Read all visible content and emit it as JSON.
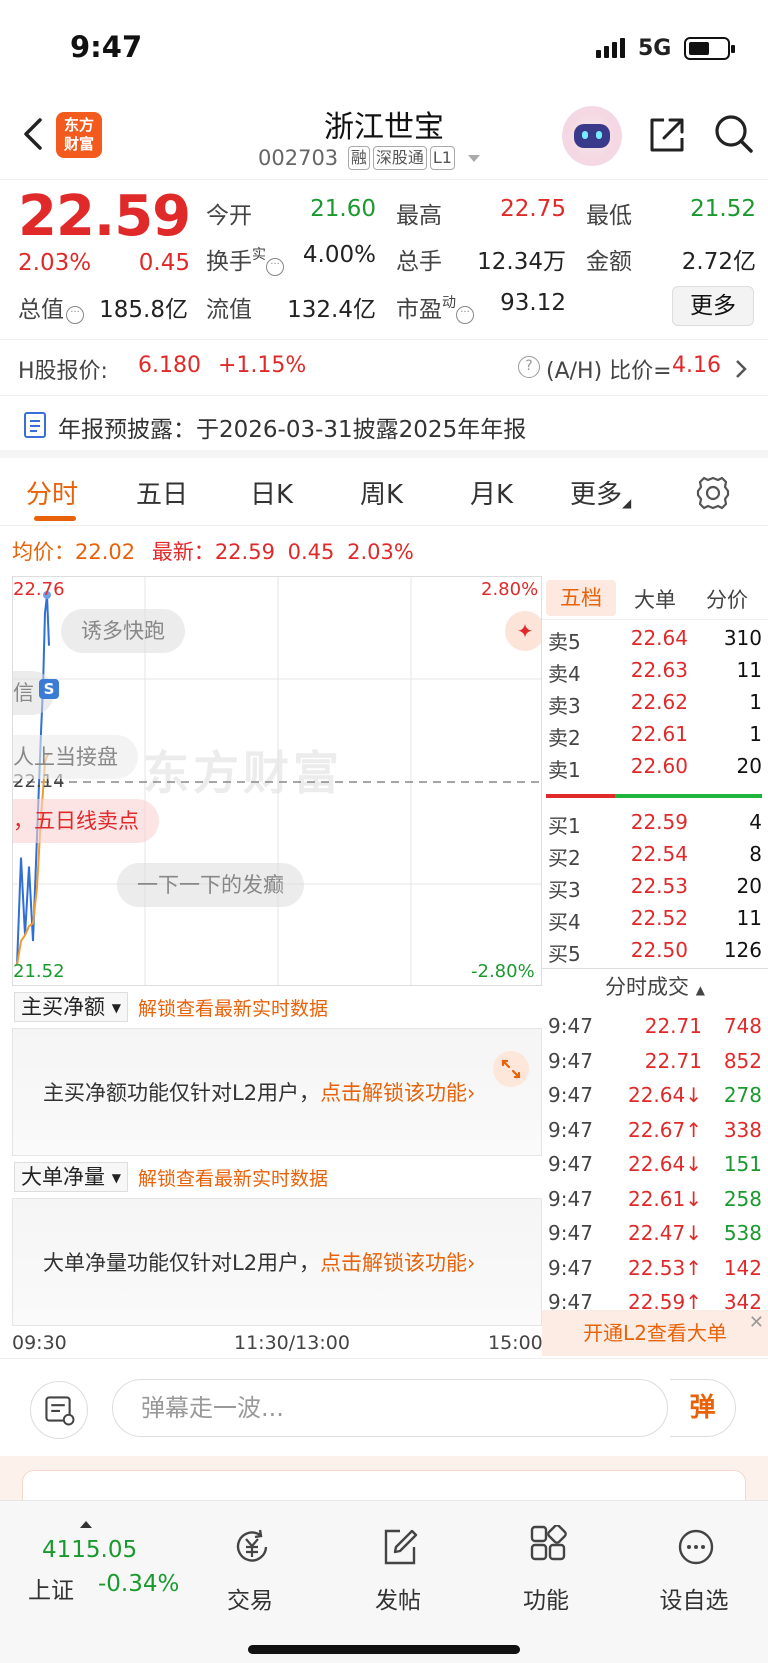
{
  "status": {
    "time": "9:47",
    "network": "5G"
  },
  "header": {
    "logo_line1": "东方",
    "logo_line2": "财富",
    "name": "浙江世宝",
    "code": "002703",
    "tags": [
      "融",
      "深股通",
      "L1"
    ]
  },
  "quote": {
    "price": "22.59",
    "pct": "2.03%",
    "change": "0.45",
    "open_label": "今开",
    "open": "21.60",
    "high_label": "最高",
    "high": "22.75",
    "low_label": "最低",
    "low": "21.52",
    "turnover_label": "换手",
    "turnover_sup": "实",
    "turnover": "4.00%",
    "volume_label": "总手",
    "volume": "12.34万",
    "amount_label": "金额",
    "amount": "2.72亿",
    "mktcap_label": "总值",
    "mktcap": "185.8亿",
    "float_label": "流值",
    "float": "132.4亿",
    "pe_label": "市盈",
    "pe_sup": "动",
    "pe": "93.12",
    "more": "更多"
  },
  "hshare": {
    "label": "H股报价:",
    "price": "6.180",
    "change": "+1.15%",
    "ah_label": "(A/H) 比价=",
    "ah_value": "4.16"
  },
  "annual": {
    "text": "年报预披露：于2026-03-31披露2025年年报"
  },
  "tabs": [
    "分时",
    "五日",
    "日K",
    "周K",
    "月K",
    "更多"
  ],
  "infoline": {
    "avg_label": "均价：",
    "avg": "22.02",
    "last_label": "最新：",
    "last": "22.59",
    "change": "0.45",
    "pct": "2.03%"
  },
  "chart": {
    "y_top": "22.76",
    "y_mid": "22.14",
    "y_bottom": "21.52",
    "pct_top": "2.80%",
    "pct_bottom": "-2.80%",
    "x_labels": [
      "09:30",
      "11:30/13:00",
      "15:00"
    ],
    "marker": "S",
    "watermark": "东方财富",
    "danmaku": [
      "诱多快跑",
      "信",
      "人上当接盘",
      "，五日线卖点",
      "一下一下的发癫"
    ]
  },
  "chart_data": {
    "type": "line",
    "ylim": [
      21.52,
      22.76
    ],
    "series": [
      {
        "values": [
          21.52,
          21.88,
          21.62,
          21.85,
          21.6,
          21.95,
          22.3,
          22.45,
          22.7,
          22.76,
          22.59
        ]
      },
      {
        "values": [
          21.52,
          21.6,
          21.62,
          21.65,
          21.66,
          21.78,
          22.02,
          22.1,
          22.2,
          22.22,
          22.23
        ]
      }
    ]
  },
  "orderbook": {
    "tabs": [
      "五档",
      "大单",
      "分价"
    ],
    "asks": [
      {
        "label": "卖5",
        "price": "22.64",
        "vol": "310"
      },
      {
        "label": "卖4",
        "price": "22.63",
        "vol": "11"
      },
      {
        "label": "卖3",
        "price": "22.62",
        "vol": "1"
      },
      {
        "label": "卖2",
        "price": "22.61",
        "vol": "1"
      },
      {
        "label": "卖1",
        "price": "22.60",
        "vol": "20"
      }
    ],
    "bids": [
      {
        "label": "买1",
        "price": "22.59",
        "vol": "4"
      },
      {
        "label": "买2",
        "price": "22.54",
        "vol": "8"
      },
      {
        "label": "买3",
        "price": "22.53",
        "vol": "20"
      },
      {
        "label": "买4",
        "price": "22.52",
        "vol": "11"
      },
      {
        "label": "买5",
        "price": "22.50",
        "vol": "126"
      }
    ],
    "ticks_title": "分时成交",
    "ticks": [
      {
        "time": "9:47",
        "price": "22.71",
        "vol": "748",
        "dir": ""
      },
      {
        "time": "9:47",
        "price": "22.71",
        "vol": "852",
        "dir": ""
      },
      {
        "time": "9:47",
        "price": "22.64↓",
        "vol": "278",
        "dir": "down"
      },
      {
        "time": "9:47",
        "price": "22.67↑",
        "vol": "338",
        "dir": "up"
      },
      {
        "time": "9:47",
        "price": "22.64↓",
        "vol": "151",
        "dir": "down"
      },
      {
        "time": "9:47",
        "price": "22.61↓",
        "vol": "258",
        "dir": "down"
      },
      {
        "time": "9:47",
        "price": "22.47↓",
        "vol": "538",
        "dir": "down"
      },
      {
        "time": "9:47",
        "price": "22.53↑",
        "vol": "142",
        "dir": "up"
      },
      {
        "time": "9:47",
        "price": "22.59↑",
        "vol": "342",
        "dir": "up"
      }
    ],
    "l2_cta": "开通L2查看大单"
  },
  "panels": [
    {
      "select": "主买净额",
      "link": "解锁查看最新实时数据",
      "msg": "主买净额功能仅针对L2用户，",
      "cta": "点击解锁该功能›"
    },
    {
      "select": "大单净量",
      "link": "解锁查看最新实时数据",
      "msg": "大单净量功能仅针对L2用户，",
      "cta": "点击解锁该功能›"
    }
  ],
  "danmaku_bar": {
    "placeholder": "弹幕走一波...",
    "send": "弹"
  },
  "bottomnav": {
    "index_value": "4115.05",
    "index_label": "上证",
    "index_change": "-0.34%",
    "items": [
      "交易",
      "发帖",
      "功能",
      "设自选"
    ]
  }
}
